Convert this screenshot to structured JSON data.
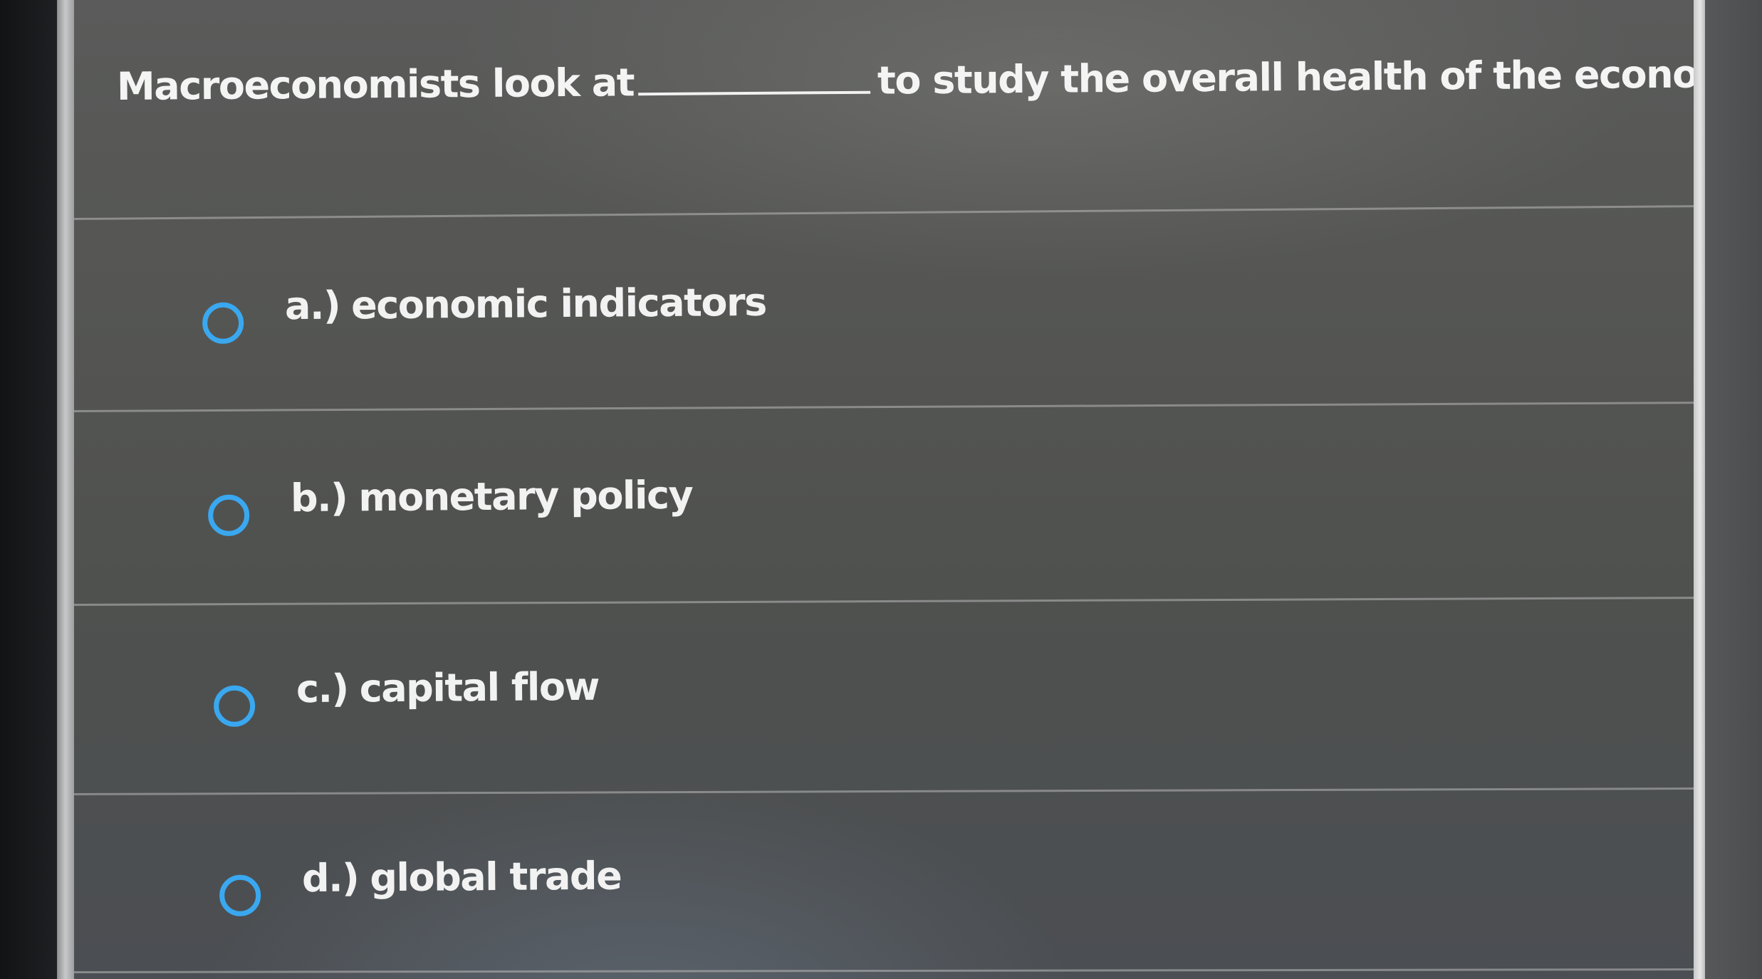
{
  "question": {
    "before_blank": "Macroeconomists look at",
    "after_blank": "to study the overall health of the economy."
  },
  "options": [
    {
      "letter": "a.)",
      "text": "economic indicators"
    },
    {
      "letter": "b.)",
      "text": "monetary policy"
    },
    {
      "letter": "c.)",
      "text": "capital flow"
    },
    {
      "letter": "d.)",
      "text": "global trade"
    }
  ],
  "colors": {
    "radio_ring": "#3aa8f0",
    "text": "#f2f2f2",
    "panel": "#555653"
  }
}
